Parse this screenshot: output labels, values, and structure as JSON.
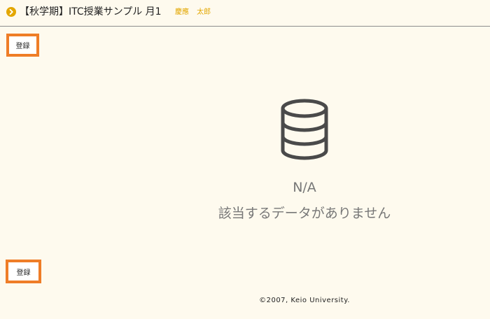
{
  "header": {
    "title": "【秋学期】ITC授業サンプル 月1",
    "teacher": "慶應 太郎"
  },
  "actions": {
    "register_top_label": "登録",
    "register_bottom_label": "登録"
  },
  "empty_state": {
    "status": "N/A",
    "message": "該当するデータがありません",
    "icon": "database-icon"
  },
  "footer": {
    "copyright": "©2007, Keio University."
  },
  "colors": {
    "background": "#fefaee",
    "accent_orange": "#ef7d27",
    "teacher_gold": "#e3a700",
    "icon_gray": "#4a4a4a",
    "muted_text": "#777777"
  }
}
